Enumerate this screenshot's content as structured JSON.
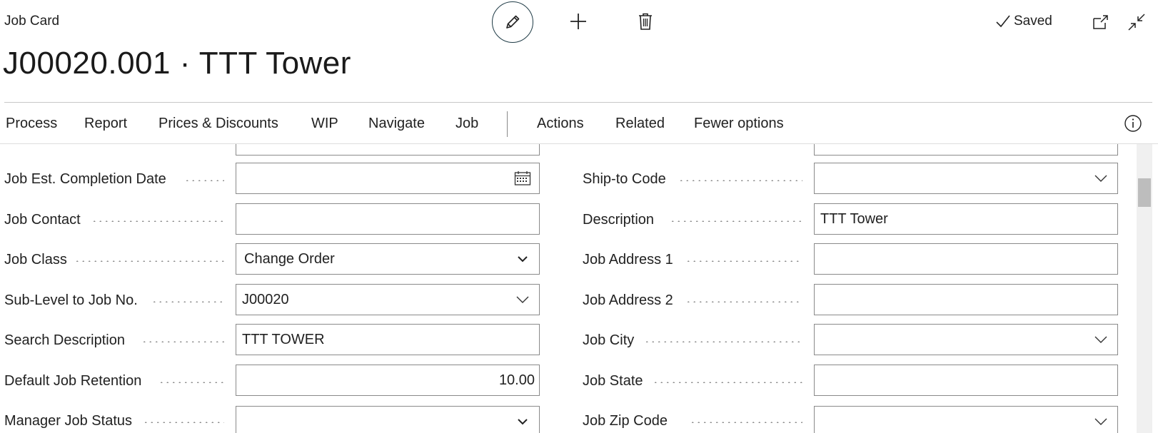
{
  "header": {
    "page_kind": "Job Card",
    "title": "J00020.001 · TTT Tower",
    "saved_label": "Saved",
    "icons": [
      "pencil-icon",
      "plus-icon",
      "trash-icon",
      "checkmark-icon",
      "open-new-window-icon",
      "collapse-icon"
    ]
  },
  "action_bar": {
    "items": [
      "Process",
      "Report",
      "Prices & Discounts",
      "WIP",
      "Navigate",
      "Job",
      "Actions",
      "Related",
      "Fewer options"
    ],
    "info_icon": "info-icon"
  },
  "form": {
    "left": [
      {
        "label": "Job Est. Completion Date",
        "value": "",
        "control": "date"
      },
      {
        "label": "Job Contact",
        "value": "",
        "control": "text"
      },
      {
        "label": "Job Class",
        "value": "Change Order",
        "control": "select"
      },
      {
        "label": "Sub-Level to Job No.",
        "value": "J00020",
        "control": "lookup"
      },
      {
        "label": "Search Description",
        "value": "TTT TOWER",
        "control": "text"
      },
      {
        "label": "Default Job Retention",
        "value": "10.00",
        "control": "number"
      },
      {
        "label": "Manager Job Status",
        "value": "",
        "control": "select"
      }
    ],
    "right": [
      {
        "label": "Ship-to Code",
        "value": "",
        "control": "lookup"
      },
      {
        "label": "Description",
        "value": "TTT Tower",
        "control": "text"
      },
      {
        "label": "Job Address 1",
        "value": "",
        "control": "text"
      },
      {
        "label": "Job Address 2",
        "value": "",
        "control": "text"
      },
      {
        "label": "Job City",
        "value": "",
        "control": "lookup"
      },
      {
        "label": "Job State",
        "value": "",
        "control": "text"
      },
      {
        "label": "Job Zip Code",
        "value": "",
        "control": "lookup"
      }
    ]
  }
}
